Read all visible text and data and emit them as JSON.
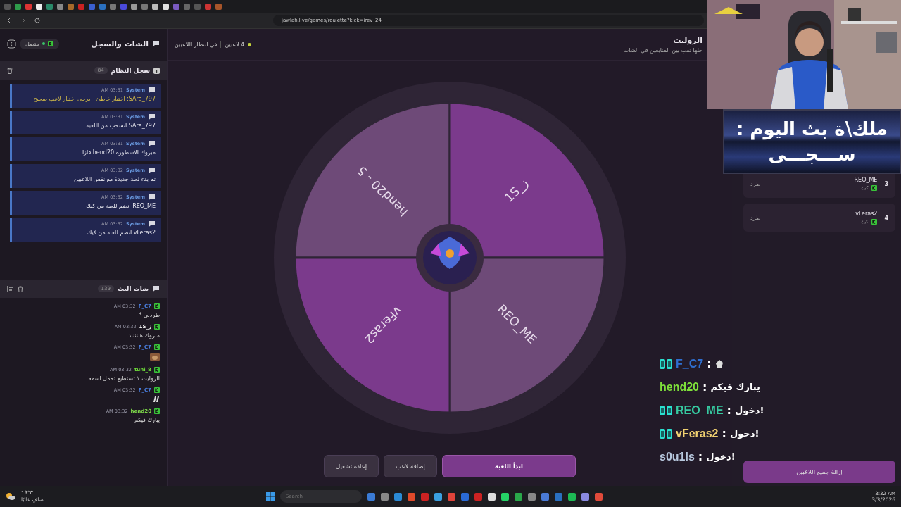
{
  "browser": {
    "url": "jawlah.live/games/roulette?kick=irev_24"
  },
  "sidebar": {
    "title": "الشات والسجل",
    "status": "متصل",
    "system_log": {
      "title": "سجل النظام",
      "count": "84",
      "messages": [
        {
          "sender": "System",
          "time": "03:31 AM",
          "text": "SAra_797: اختيار خاطئ - يرجى اختيار لاعب صحيح",
          "kind": "warning"
        },
        {
          "sender": "System",
          "time": "03:31 AM",
          "text": "SAra_797 انسحب من اللعبة",
          "kind": "info"
        },
        {
          "sender": "System",
          "time": "03:31 AM",
          "text": "مبروك الاسطورة hend20 فازا",
          "kind": "info"
        },
        {
          "sender": "System",
          "time": "03:32 AM",
          "text": "تم بدء لعبة جديدة مع نفس اللاعبين",
          "kind": "info"
        },
        {
          "sender": "System",
          "time": "03:32 AM",
          "text": "REO_ME انضم للعبة من كيك",
          "kind": "info"
        },
        {
          "sender": "System",
          "time": "03:32 AM",
          "text": "vFeras2 انضم للعبة من كيك",
          "kind": "info"
        }
      ]
    },
    "stream_chat": {
      "title": "شات البث",
      "count": "139",
      "messages": [
        {
          "user": "F_C7",
          "color": "#4a7fe0",
          "time": "03:32 AM",
          "kind": "text",
          "text": "طردني *"
        },
        {
          "user": "ز_1S",
          "color": "#e8e8e8",
          "time": "03:32 AM",
          "kind": "text",
          "text": "مبروك هننننند"
        },
        {
          "user": "F_C7",
          "color": "#4a7fe0",
          "time": "03:32 AM"
        },
        {
          "user": "tuni_8",
          "color": "#6fdc3a",
          "time": "03:32 AM",
          "kind": "text",
          "text": "الروليت لا تستطيع تحمل اسمه"
        },
        {
          "user": "F_C7",
          "color": "#4a7fe0",
          "time": "03:32 AM",
          "kind": "emote"
        },
        {
          "user": "hend20",
          "color": "#7ed84a",
          "time": "03:32 AM",
          "kind": "text",
          "text": "يبارك فيكم"
        }
      ]
    }
  },
  "game": {
    "title": "الروليت",
    "subtitle": "خلها تقب بين المتابعين في الشات",
    "player_count": "4 لاعبين",
    "state": "في انتظار اللاعبين",
    "wheel": [
      {
        "label": "hend20 - 5",
        "color": "#6e4a78"
      },
      {
        "label": "ز_1S",
        "color": "#7b3a8c"
      },
      {
        "label": "REO_ME",
        "color": "#6e4a78"
      },
      {
        "label": "vFeras2",
        "color": "#7b3a8c"
      }
    ],
    "buttons": [
      {
        "label": "ابدأ اللعبة",
        "kind": "primary"
      },
      {
        "label": "إضافة لاعب",
        "kind": "secondary"
      },
      {
        "label": "إعادة تشغيل",
        "kind": "secondary"
      }
    ]
  },
  "players": {
    "rows": [
      {
        "number": "3",
        "name": "REO_ME",
        "platform": "كيك",
        "action": "طرد"
      },
      {
        "number": "4",
        "name": "vFeras2",
        "platform": "كيك",
        "action": "طرد"
      }
    ],
    "clear_button": "إزالة جميع اللاعبين"
  },
  "stream_overlay": {
    "banner_title": "ملك\\ة بث اليوم :",
    "banner_name": "ســـجـــى",
    "chat": [
      {
        "user": "F_C7",
        "color": "#2f6fd0",
        "badge": true,
        "separator": ":",
        "kind": "emote"
      },
      {
        "user": "hend20",
        "color": "#7ee03a",
        "badge": false,
        "separator": ":",
        "kind": "text",
        "text": "يبارك فيكم"
      },
      {
        "user": "REO_ME",
        "color": "#36c9a0",
        "badge": true,
        "separator": ":",
        "kind": "text",
        "text": "دخول!"
      },
      {
        "user": "vFeras2",
        "color": "#f0d070",
        "badge": true,
        "separator": ":",
        "kind": "text",
        "text": "دخول!"
      },
      {
        "user": "s0u1ls",
        "color": "#b8c8de",
        "badge": false,
        "separator": ":",
        "kind": "text",
        "text": "دخول!"
      }
    ]
  },
  "taskbar": {
    "temperature": "19°C",
    "weather": "صافٍ غالبًا",
    "search_placeholder": "Search",
    "time": "3:32 AM",
    "date": "3/3/2026"
  }
}
